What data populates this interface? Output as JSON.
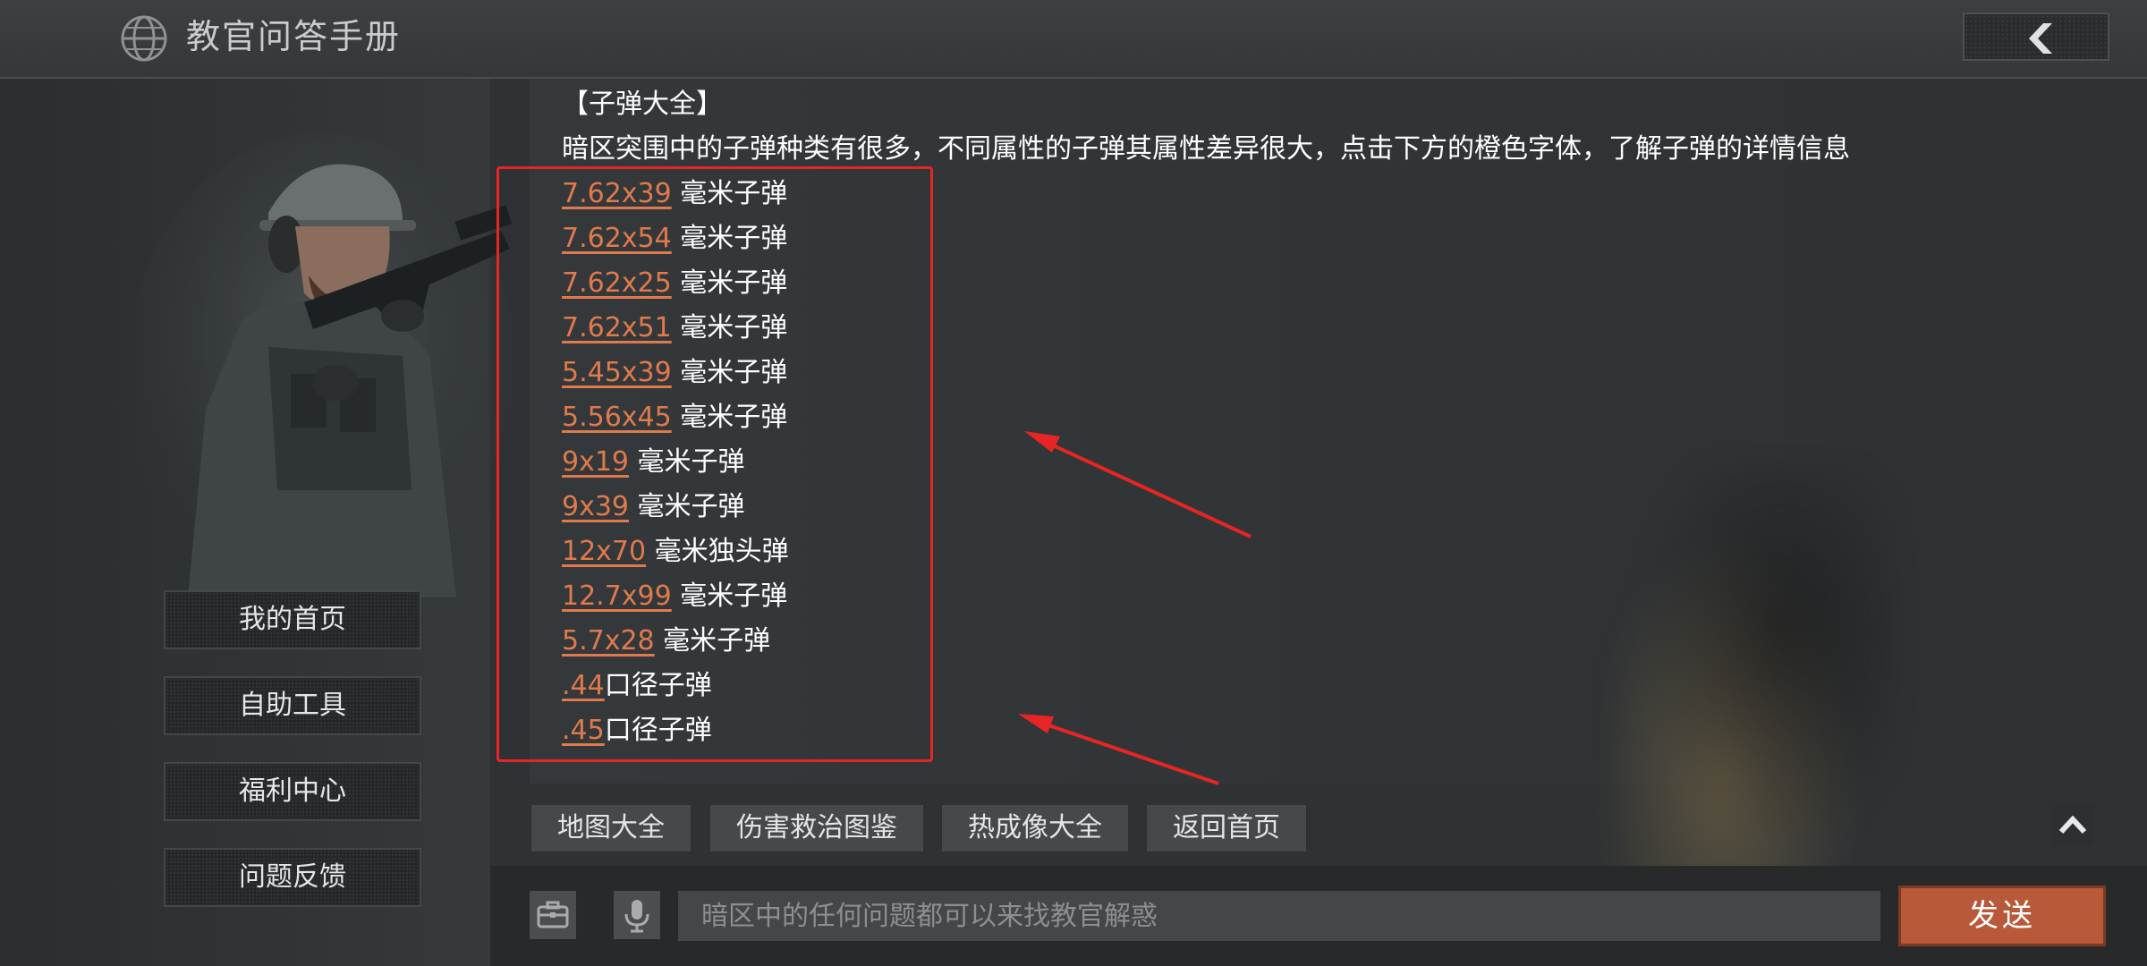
{
  "header": {
    "title": "教官问答手册",
    "back_icon": "chevron-left-icon"
  },
  "sidebar": {
    "items": [
      {
        "label": "我的首页"
      },
      {
        "label": "自助工具"
      },
      {
        "label": "福利中心"
      },
      {
        "label": "问题反馈"
      }
    ]
  },
  "message": {
    "heading": "【子弹大全】",
    "intro": "暗区突围中的子弹种类有很多，不同属性的子弹其属性差异很大，点击下方的橙色字体，了解子弹的详情信息",
    "ammo": [
      {
        "caliber": "7.62x39",
        "suffix": " 毫米子弹"
      },
      {
        "caliber": "7.62x54",
        "suffix": " 毫米子弹"
      },
      {
        "caliber": "7.62x25",
        "suffix": " 毫米子弹"
      },
      {
        "caliber": "7.62x51",
        "suffix": " 毫米子弹"
      },
      {
        "caliber": "5.45x39",
        "suffix": " 毫米子弹"
      },
      {
        "caliber": "5.56x45",
        "suffix": " 毫米子弹"
      },
      {
        "caliber": "9x19",
        "suffix": " 毫米子弹"
      },
      {
        "caliber": "9x39",
        "suffix": " 毫米子弹"
      },
      {
        "caliber": "12x70",
        "suffix": " 毫米独头弹"
      },
      {
        "caliber": "12.7x99",
        "suffix": " 毫米子弹"
      },
      {
        "caliber": "5.7x28",
        "suffix": " 毫米子弹"
      },
      {
        "caliber": ".44",
        "suffix": "口径子弹"
      },
      {
        "caliber": ".45",
        "suffix": "口径子弹"
      }
    ],
    "link_color": "#e07a4c"
  },
  "quick_tabs": [
    {
      "label": "地图大全"
    },
    {
      "label": "伤害救治图鉴"
    },
    {
      "label": "热成像大全"
    },
    {
      "label": "返回首页"
    }
  ],
  "input_bar": {
    "placeholder": "暗区中的任何问题都可以来找教官解惑",
    "send_label": "发送",
    "toolbox_icon": "toolbox-icon",
    "mic_icon": "microphone-icon"
  },
  "annotation": {
    "highlight_color": "#e82525"
  }
}
